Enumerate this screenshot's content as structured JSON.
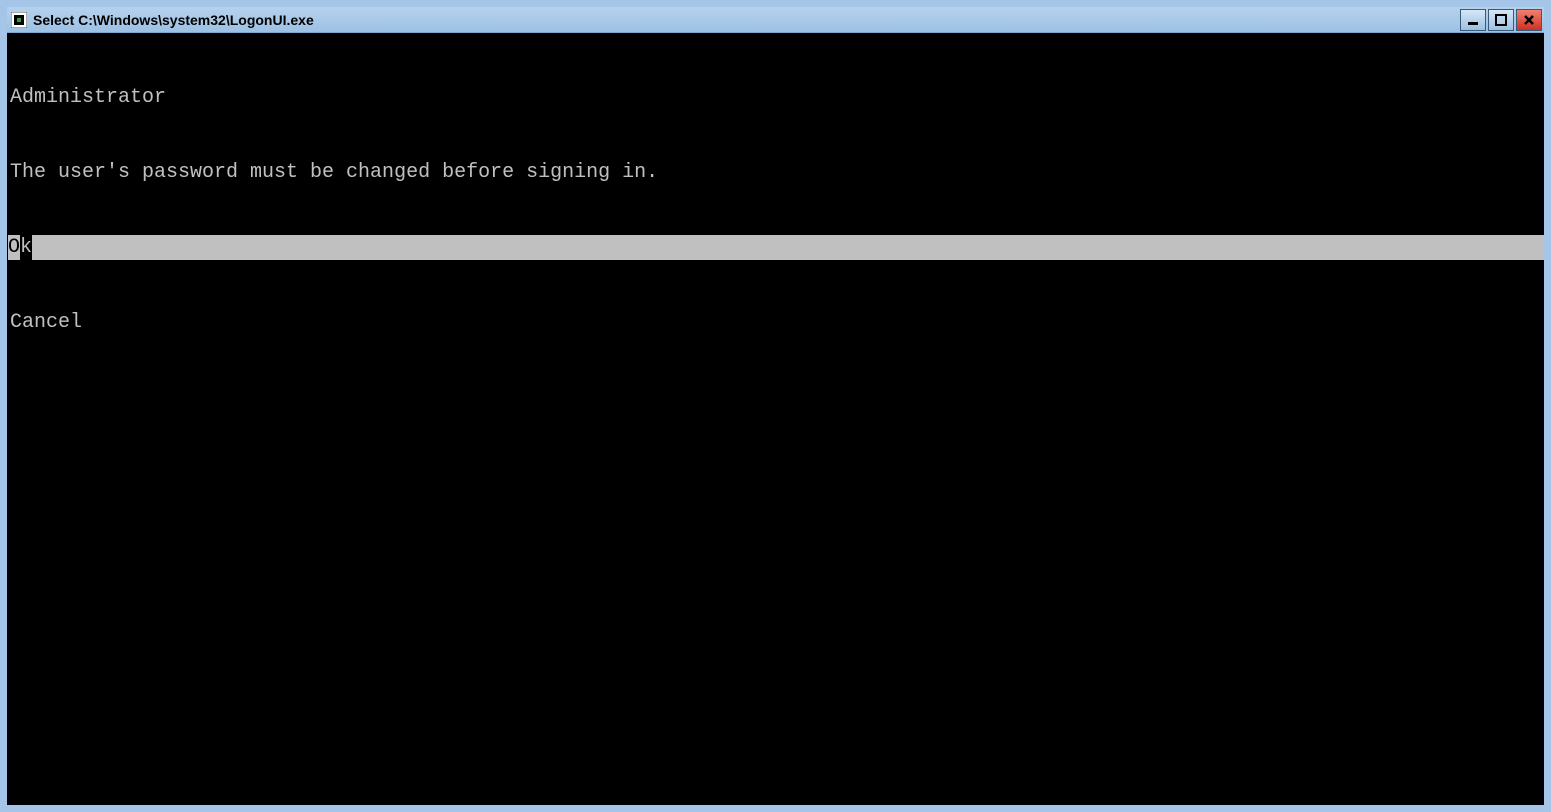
{
  "window": {
    "title": "Select C:\\Windows\\system32\\LogonUI.exe"
  },
  "console": {
    "user": "Administrator",
    "message": "The user's password must be changed before signing in.",
    "ok": "Ok",
    "cancel": "Cancel"
  }
}
